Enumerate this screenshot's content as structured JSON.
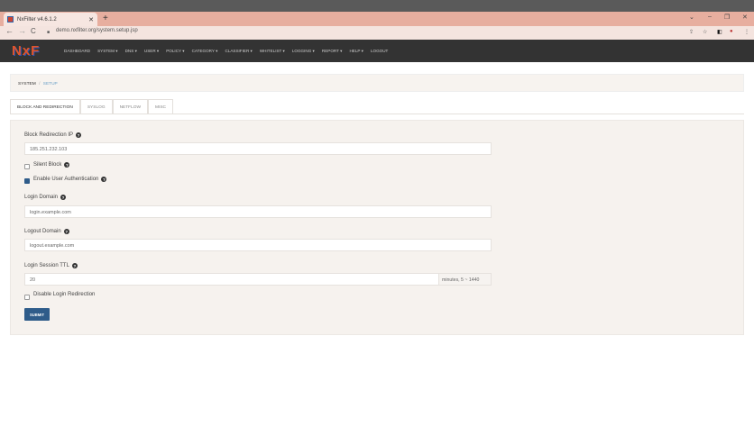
{
  "browser": {
    "tab_title": "NxFilter v4.6.1.2",
    "url": "demo.nxfilter.org/system.setup.jsp"
  },
  "nav": {
    "logo": "NxF",
    "items": [
      "DASHBOARD",
      "SYSTEM ▾",
      "DNS ▾",
      "USER ▾",
      "POLICY ▾",
      "CATEGORY ▾",
      "CLASSIFIER ▾",
      "WHITELIST ▾",
      "LOGGING ▾",
      "REPORT ▾",
      "HELP ▾",
      "LOGOUT"
    ]
  },
  "breadcrumb": {
    "parent": "SYSTEM",
    "sep": "/",
    "current": "SETUP"
  },
  "tabs": [
    "BLOCK AND REDIRECTION",
    "SYSLOG",
    "NETFLOW",
    "MISC"
  ],
  "form": {
    "block_ip_label": "Block Redirection IP",
    "block_ip_value": "185.251.232.103",
    "silent_block_label": "Silent Block",
    "silent_block_checked": false,
    "enable_auth_label": "Enable User Authentication",
    "enable_auth_checked": true,
    "login_domain_label": "Login Domain",
    "login_domain_value": "login.example.com",
    "logout_domain_label": "Logout Domain",
    "logout_domain_value": "logout.example.com",
    "ttl_label": "Login Session TTL",
    "ttl_value": "20",
    "ttl_addon": "minutes, 5 ~ 1440",
    "disable_redirect_label": "Disable Login Redirection",
    "disable_redirect_checked": false,
    "submit": "SUBMIT"
  }
}
